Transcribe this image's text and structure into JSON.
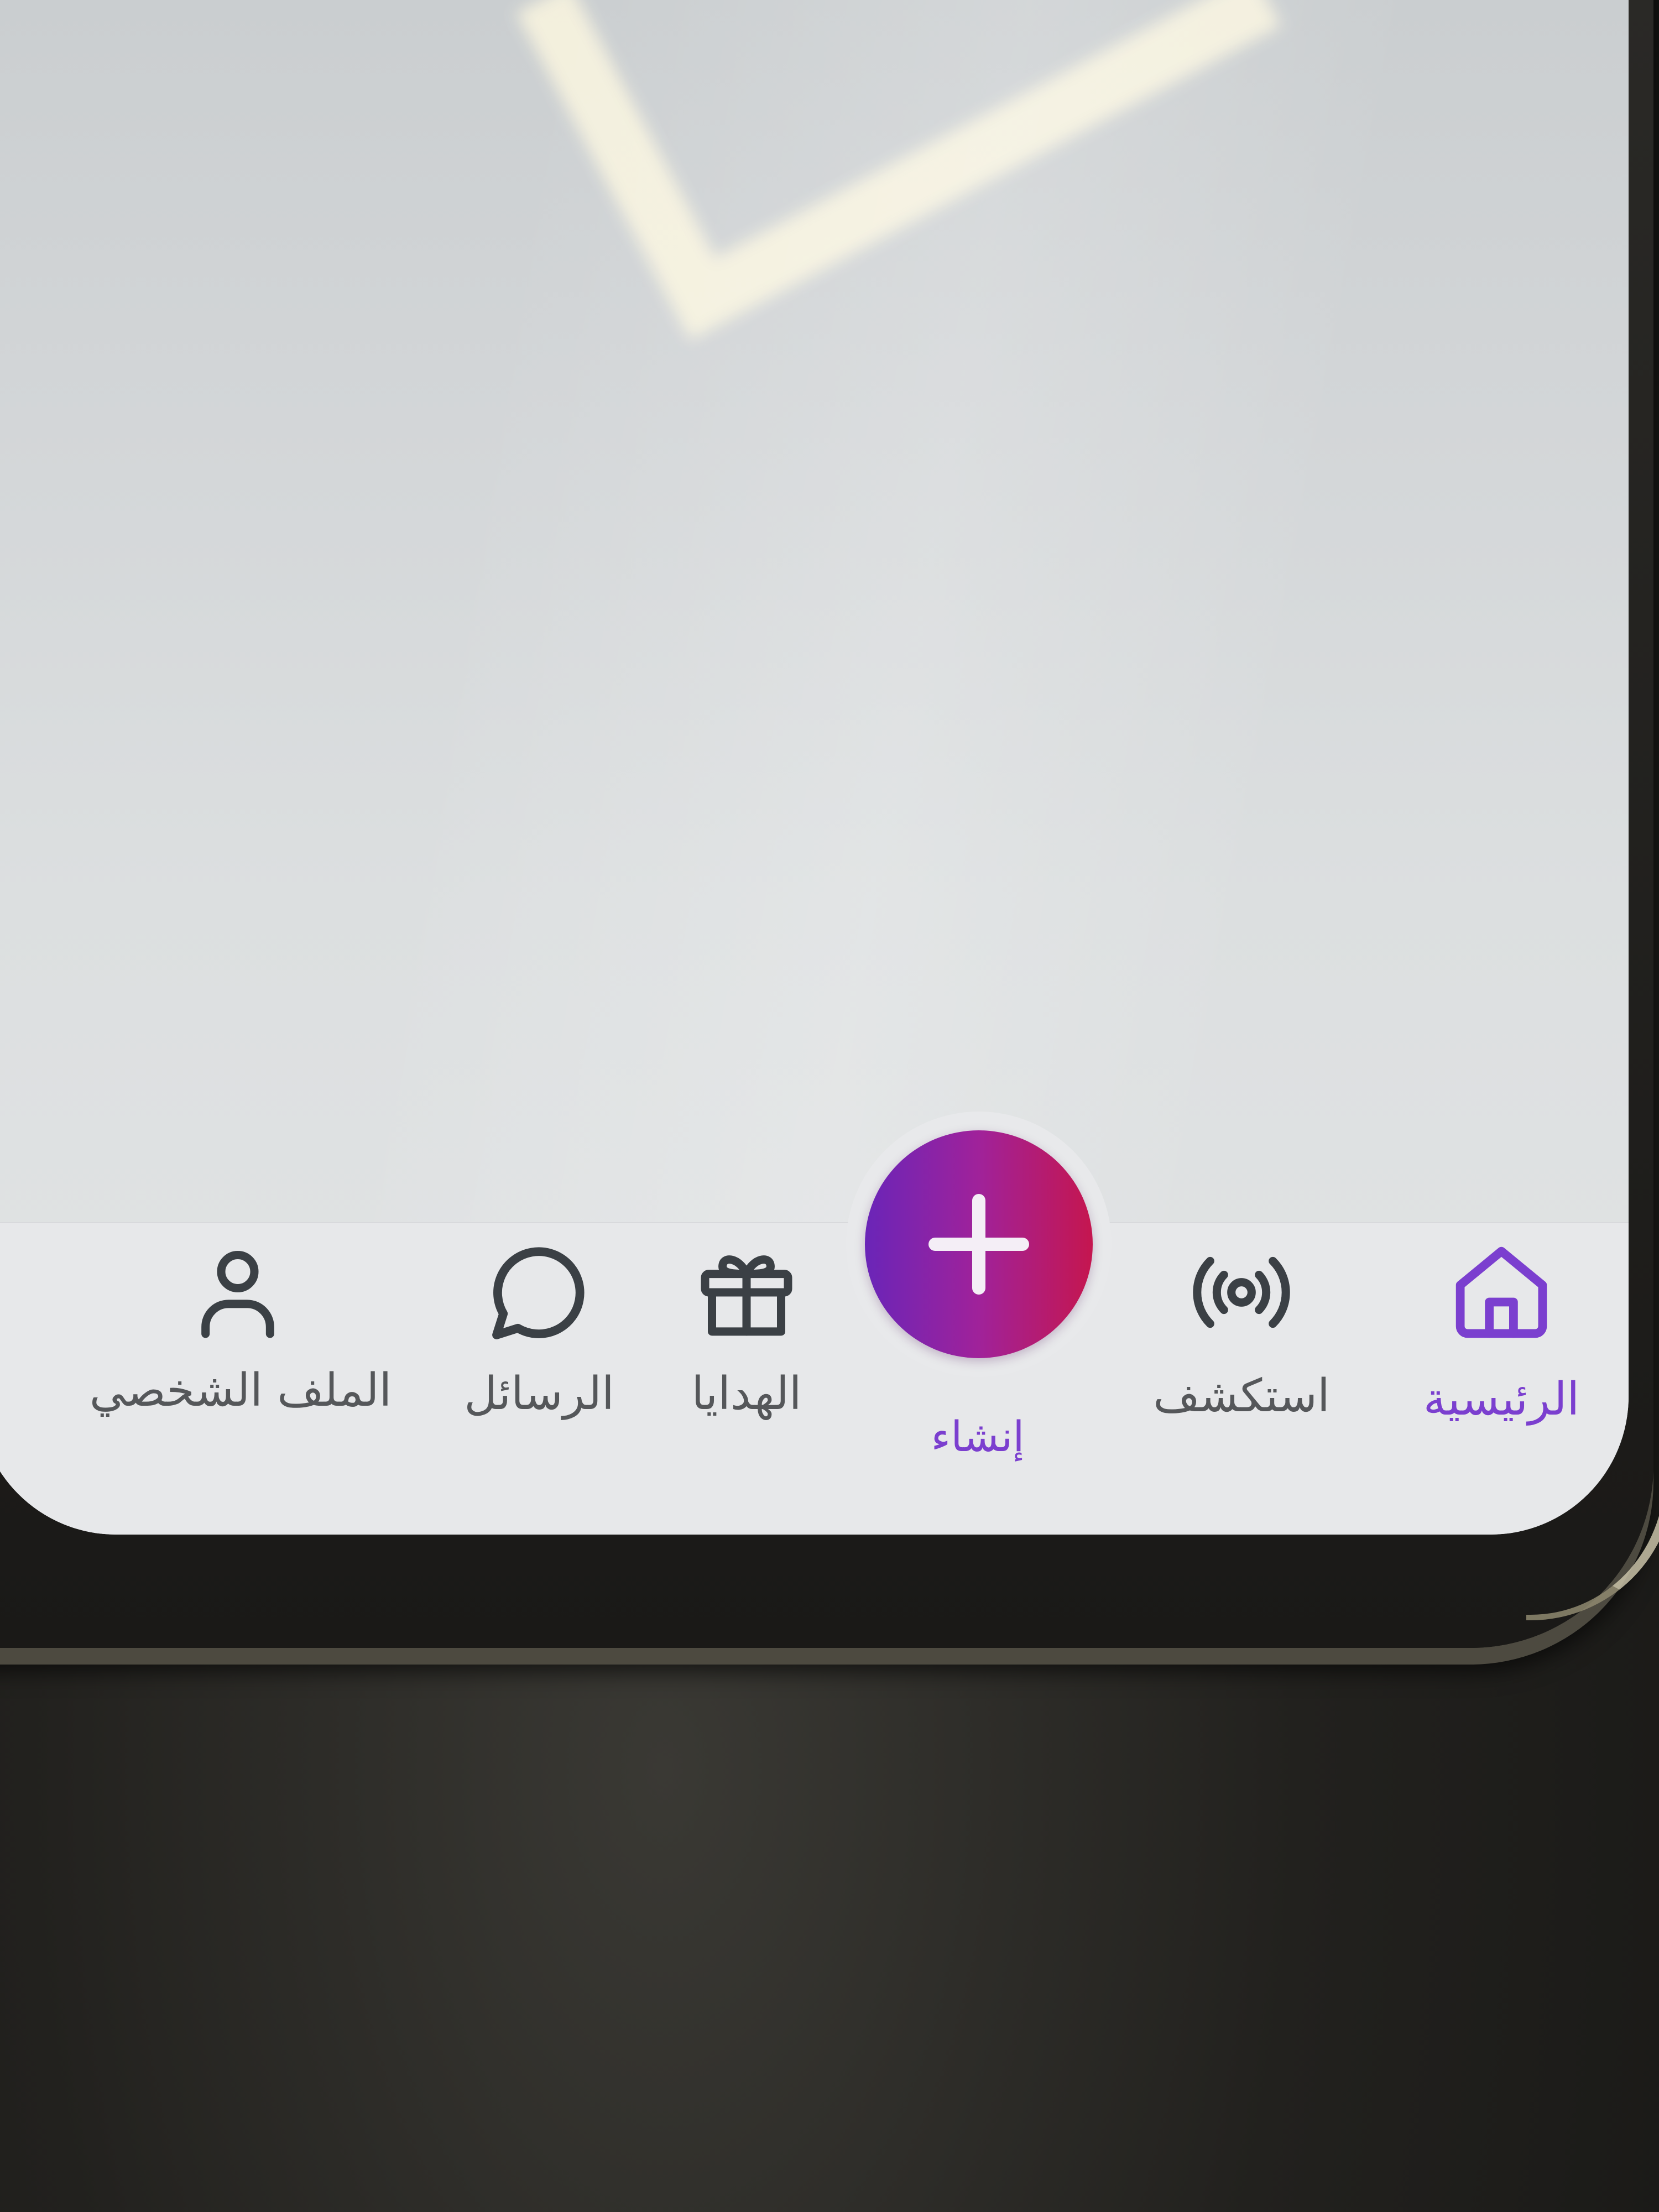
{
  "theme": {
    "accent": "#7b3fcf",
    "idle_icon": "#3b4045",
    "fab_gradient_start": "#6a25b8",
    "fab_gradient_end": "#c5164f"
  },
  "bottom_nav": {
    "active_item": "home",
    "items": [
      {
        "id": "home",
        "label": "الرئيسية",
        "icon": "home-icon",
        "active": true
      },
      {
        "id": "explore",
        "label": "استكشف",
        "icon": "broadcast-icon",
        "active": false
      },
      {
        "id": "create",
        "label": "إنشاء",
        "icon": "plus-icon",
        "active": false
      },
      {
        "id": "gifts",
        "label": "الهدايا",
        "icon": "gift-icon",
        "active": false
      },
      {
        "id": "messages",
        "label": "الرسائل",
        "icon": "chat-bubble-icon",
        "active": false
      },
      {
        "id": "profile",
        "label": "الملف الشخصي",
        "icon": "user-icon",
        "active": false
      }
    ]
  }
}
